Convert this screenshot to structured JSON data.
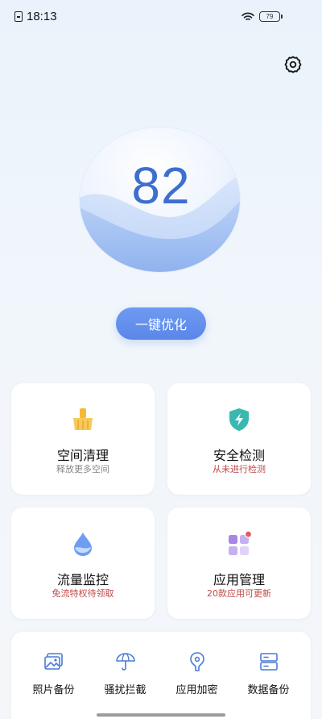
{
  "status_bar": {
    "time": "18:13",
    "battery": "79"
  },
  "score": {
    "value": "82"
  },
  "optimize_button": {
    "label": "一键优化"
  },
  "cards": [
    {
      "title": "空间清理",
      "subtitle": "释放更多空间",
      "icon": "broom-icon"
    },
    {
      "title": "安全检测",
      "subtitle": "从未进行检测",
      "icon": "shield-bolt-icon"
    },
    {
      "title": "流量监控",
      "subtitle": "免流特权待领取",
      "icon": "droplet-icon"
    },
    {
      "title": "应用管理",
      "subtitle": "20款应用可更新",
      "icon": "apps-grid-icon"
    }
  ],
  "tools": [
    {
      "label": "照片备份",
      "icon": "photo-icon"
    },
    {
      "label": "骚扰拦截",
      "icon": "umbrella-icon"
    },
    {
      "label": "应用加密",
      "icon": "lock-icon"
    },
    {
      "label": "数据备份",
      "icon": "database-icon"
    }
  ],
  "colors": {
    "accent": "#5a86e8",
    "score": "#3e6fce",
    "warning": "#c04a4a",
    "icon_blue": "#4a7bd6",
    "clean_orange": "#f5b93a",
    "security_teal": "#39b8b0",
    "apps_purple": "#9b7be0",
    "badge_red": "#e85a5a"
  }
}
